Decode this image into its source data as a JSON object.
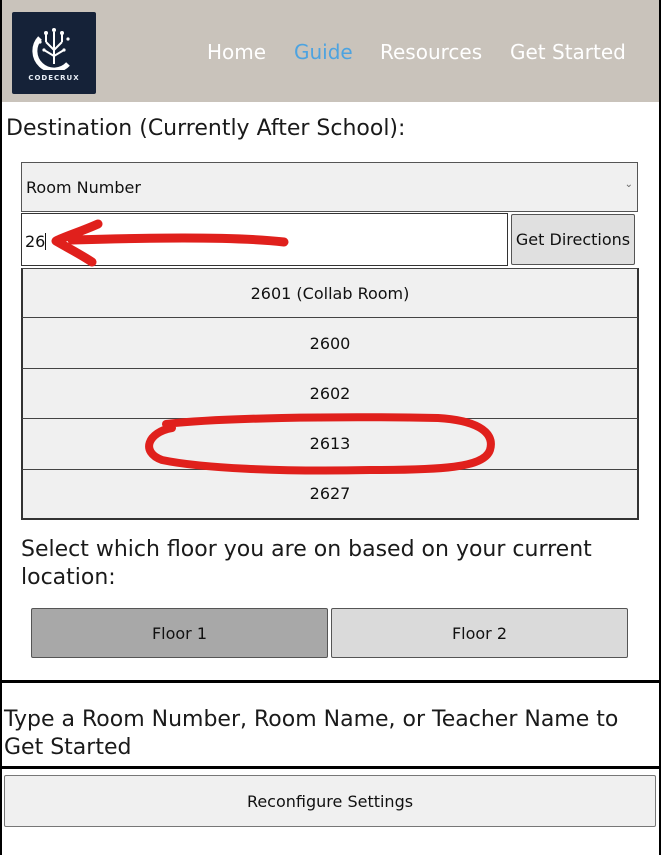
{
  "nav": {
    "logo_text": "CODECRUX",
    "links": [
      {
        "label": "Home",
        "active": false
      },
      {
        "label": "Guide",
        "active": true
      },
      {
        "label": "Resources",
        "active": false
      },
      {
        "label": "Get Started",
        "active": false
      }
    ],
    "bar_color": "#c9c3bb",
    "active_color": "#4da3e0"
  },
  "destination": {
    "heading": "Destination (Currently After School):",
    "select_value": "Room Number",
    "search_value": "26",
    "get_directions_label": "Get Directions",
    "results": [
      "2601 (Collab Room)",
      "2600",
      "2602",
      "2613",
      "2627"
    ]
  },
  "floor": {
    "heading": "Select which floor you are on based on your current location:",
    "buttons": [
      "Floor 1",
      "Floor 2"
    ],
    "selected": "Floor 1"
  },
  "help_text": "Type a Room Number, Room Name, or Teacher Name to Get Started",
  "reconfigure_label": "Reconfigure Settings",
  "annotation_color": "#e0201c"
}
